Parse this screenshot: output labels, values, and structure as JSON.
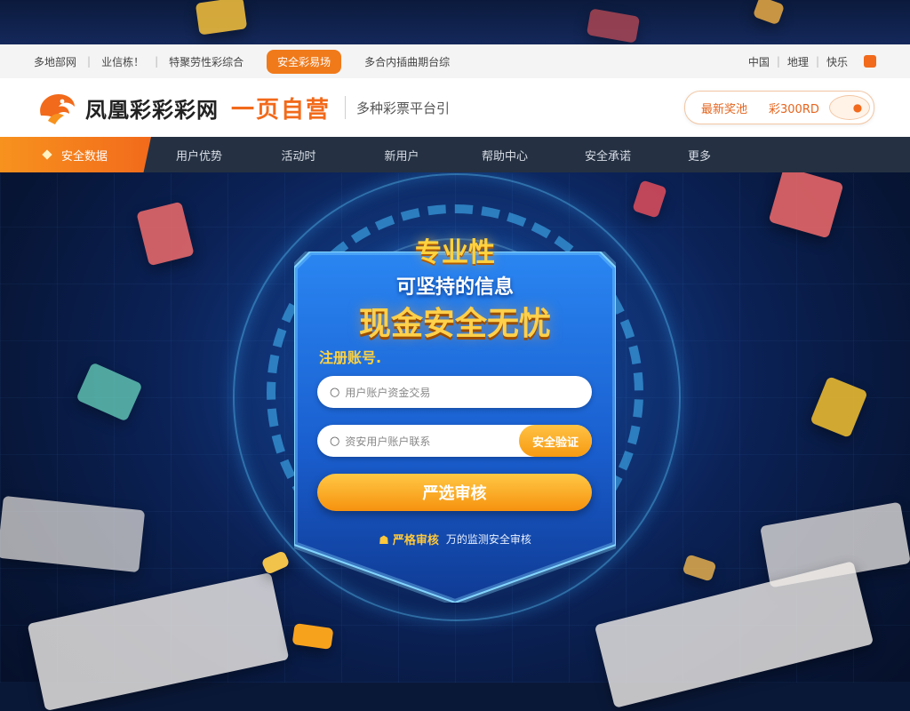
{
  "utility_bar": {
    "items": [
      "多地部网",
      "业信栋！",
      "特聚劳性彩综合"
    ],
    "hot_label": "安全彩易场",
    "tagline": "多合内插曲期台综",
    "right_items": [
      "中国",
      "地理",
      "快乐"
    ]
  },
  "header": {
    "brand_name": "凤凰彩彩彩网",
    "slogan": "一页自营",
    "description": "多种彩票平台引",
    "pill_label": "最新奖池",
    "pill_value": "彩300RD",
    "pill_icon": "arrow-right-icon"
  },
  "nav": {
    "items": [
      "安全数据",
      "用户优势",
      "活动时",
      "新用户",
      "帮助中心",
      "安全承诺",
      "更多"
    ]
  },
  "hero": {
    "line1": "专业性",
    "line2": "可坚持的信息",
    "line3": "现金安全无忧"
  },
  "form": {
    "label": "注册账号.",
    "field1_placeholder": "用户账户资金交易",
    "field2_placeholder": "资安用户账户联系",
    "field2_button": "安全验证",
    "submit": "严选审核",
    "note_tag": "严格审核",
    "note_text": "万的监测安全审核"
  },
  "colors": {
    "accent": "#f26a1b",
    "gold": "#ffd23f",
    "nav_bg": "#253142",
    "panel_blue": "#1f6fe0"
  }
}
